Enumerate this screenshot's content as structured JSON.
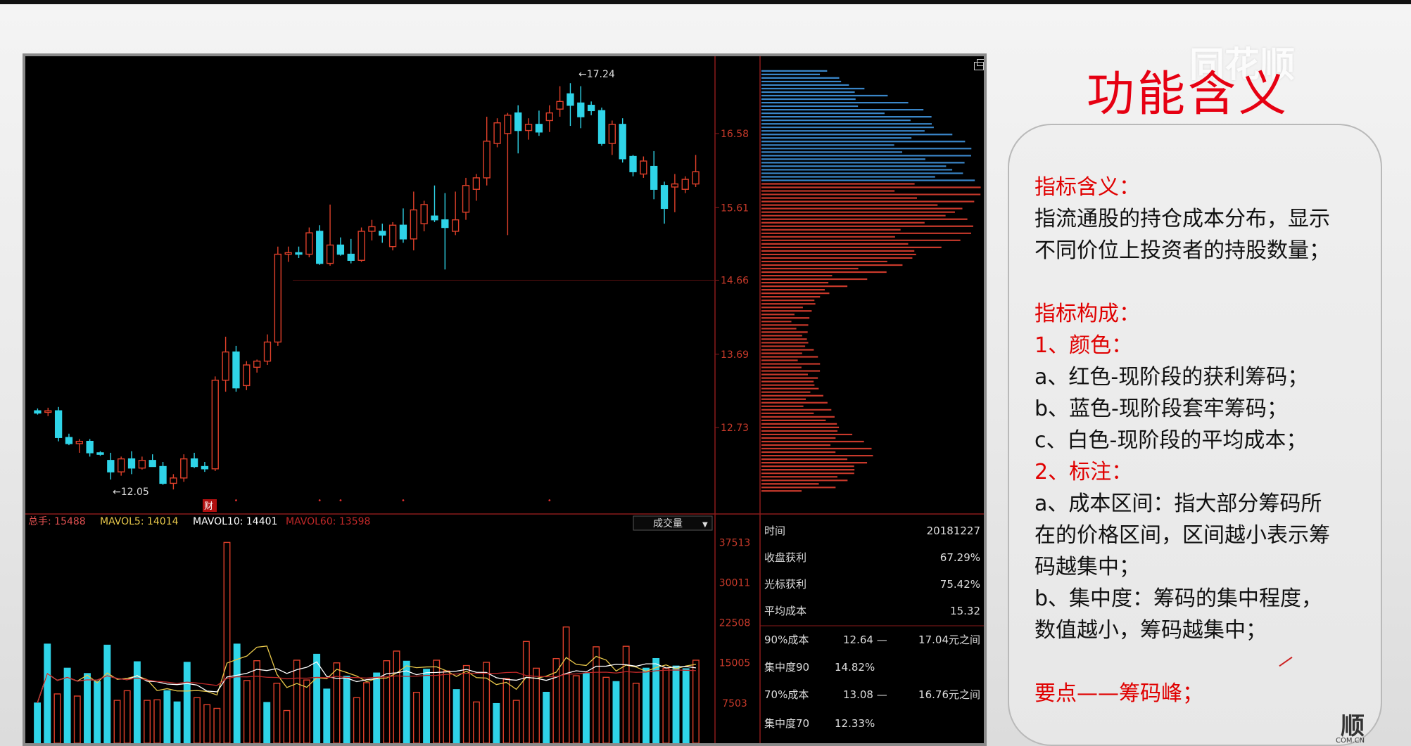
{
  "slide": {
    "title": "功能含义",
    "watermark": "同花顺",
    "corner_logo": "顺",
    "corner_url": "COM.CN"
  },
  "panel": {
    "section1_title": "指标含义：",
    "section1_line1": "指流通股的持仓成本分布，显示",
    "section1_line2": "不同价位上投资者的持股数量；",
    "section2_title": "指标构成：",
    "item1_title": "1、颜色：",
    "item1_a": "a、红色-现阶段的获利筹码；",
    "item1_b": "b、蓝色-现阶段套牢筹码；",
    "item1_c": "c、白色-现阶段的平均成本；",
    "item2_title": "2、标注：",
    "item2_a_line1": "a、成本区间：指大部分筹码所",
    "item2_a_line2": "在的价格区间，区间越小表示筹",
    "item2_a_line3": "码越集中；",
    "item2_b_line1": "b、集中度：筹码的集中程度，",
    "item2_b_line2": "数值越小，筹码越集中；",
    "keypoint": "要点——筹码峰；"
  },
  "chart_data": [
    {
      "type": "candlestick",
      "y_axis_ticks": [
        "16.58",
        "15.61",
        "14.66",
        "13.69",
        "12.73"
      ],
      "y_axis_values": [
        16.58,
        15.61,
        14.66,
        13.69,
        12.73
      ],
      "ylim": [
        11.7,
        17.5
      ],
      "high_annotation": "17.24",
      "low_annotation": "12.05",
      "event_marker": "财",
      "colors": {
        "up": "#e0402a",
        "down": "#2fd4e8",
        "red_chips": "#c8392b",
        "blue_chips": "#3a86c8"
      },
      "candles": [
        [
          12.95,
          12.98,
          12.9,
          12.92
        ],
        [
          12.93,
          12.99,
          12.88,
          12.95
        ],
        [
          12.95,
          13.0,
          12.55,
          12.6
        ],
        [
          12.6,
          12.65,
          12.5,
          12.52
        ],
        [
          12.52,
          12.58,
          12.4,
          12.55
        ],
        [
          12.55,
          12.58,
          12.35,
          12.4
        ],
        [
          12.4,
          12.42,
          12.36,
          12.38
        ],
        [
          12.3,
          12.4,
          12.05,
          12.15
        ],
        [
          12.15,
          12.35,
          12.1,
          12.32
        ],
        [
          12.32,
          12.42,
          12.12,
          12.2
        ],
        [
          12.2,
          12.35,
          12.18,
          12.3
        ],
        [
          12.3,
          12.38,
          12.22,
          12.22
        ],
        [
          12.22,
          12.28,
          11.98,
          12.0
        ],
        [
          12.0,
          12.12,
          11.92,
          12.07
        ],
        [
          12.07,
          12.38,
          12.02,
          12.32
        ],
        [
          12.32,
          12.4,
          12.2,
          12.22
        ],
        [
          12.22,
          12.28,
          12.15,
          12.19
        ],
        [
          12.19,
          13.4,
          12.16,
          13.35
        ],
        [
          13.35,
          13.92,
          13.2,
          13.72
        ],
        [
          13.72,
          13.8,
          13.2,
          13.25
        ],
        [
          13.28,
          13.6,
          13.22,
          13.55
        ],
        [
          13.52,
          13.62,
          13.45,
          13.6
        ],
        [
          13.6,
          13.95,
          13.55,
          13.85
        ],
        [
          13.85,
          15.1,
          13.8,
          15.0
        ],
        [
          15.0,
          15.1,
          14.9,
          15.02
        ],
        [
          15.02,
          15.1,
          14.95,
          15.0
        ],
        [
          15.0,
          15.35,
          14.96,
          15.28
        ],
        [
          15.3,
          15.38,
          14.86,
          14.88
        ],
        [
          14.88,
          15.65,
          14.85,
          15.12
        ],
        [
          15.12,
          15.22,
          14.98,
          15.0
        ],
        [
          15.0,
          15.2,
          14.88,
          14.92
        ],
        [
          14.92,
          15.35,
          14.9,
          15.3
        ],
        [
          15.3,
          15.45,
          15.18,
          15.36
        ],
        [
          15.3,
          15.4,
          15.15,
          15.25
        ],
        [
          15.1,
          15.42,
          15.05,
          15.38
        ],
        [
          15.38,
          15.6,
          15.15,
          15.2
        ],
        [
          15.2,
          15.82,
          15.05,
          15.58
        ],
        [
          15.4,
          15.7,
          15.3,
          15.65
        ],
        [
          15.5,
          15.9,
          15.42,
          15.45
        ],
        [
          15.45,
          15.8,
          14.8,
          15.35
        ],
        [
          15.3,
          15.82,
          15.25,
          15.45
        ],
        [
          15.55,
          16.0,
          15.45,
          15.9
        ],
        [
          15.85,
          16.05,
          15.7,
          16.0
        ],
        [
          16.0,
          16.8,
          15.9,
          16.48
        ],
        [
          16.45,
          16.78,
          16.4,
          16.72
        ],
        [
          16.58,
          16.85,
          15.25,
          16.82
        ],
        [
          16.85,
          16.95,
          16.32,
          16.62
        ],
        [
          16.62,
          16.78,
          16.5,
          16.7
        ],
        [
          16.7,
          16.88,
          16.55,
          16.6
        ],
        [
          16.75,
          16.95,
          16.6,
          16.85
        ],
        [
          16.9,
          17.2,
          16.8,
          17.0
        ],
        [
          17.1,
          17.24,
          16.68,
          16.95
        ],
        [
          16.98,
          17.2,
          16.65,
          16.8
        ],
        [
          16.95,
          17.0,
          16.82,
          16.88
        ],
        [
          16.88,
          16.92,
          16.42,
          16.45
        ],
        [
          16.45,
          16.75,
          16.3,
          16.7
        ],
        [
          16.7,
          16.78,
          16.2,
          16.25
        ],
        [
          16.28,
          16.3,
          16.02,
          16.08
        ],
        [
          16.05,
          16.28,
          16.0,
          16.22
        ],
        [
          16.15,
          16.35,
          15.72,
          15.85
        ],
        [
          15.9,
          15.95,
          15.4,
          15.6
        ],
        [
          15.88,
          16.05,
          15.55,
          15.92
        ],
        [
          15.85,
          16.02,
          15.8,
          15.98
        ],
        [
          15.92,
          16.3,
          15.88,
          16.08
        ]
      ]
    },
    {
      "type": "bar",
      "indicator_labels": {
        "total": "总手: 15488",
        "mavol5": "MAVOL5: 14014",
        "mavol10": "MAVOL10: 14401",
        "mavol60": "MAVOL60: 13598"
      },
      "dropdown": "成交量",
      "y_axis_ticks": [
        "37513",
        "30011",
        "22508",
        "15005",
        "7503"
      ],
      "ylim": [
        0,
        39000
      ],
      "values": [
        7500,
        18500,
        9200,
        14000,
        8800,
        13000,
        11500,
        18300,
        8000,
        9800,
        15200,
        8000,
        8100,
        9800,
        7700,
        15100,
        8500,
        7200,
        6500,
        37500,
        18500,
        11700,
        15400,
        7600,
        11200,
        6100,
        15500,
        11800,
        16600,
        10100,
        15000,
        12500,
        8500,
        11300,
        13100,
        15400,
        17200,
        15300,
        9500,
        13800,
        15500,
        13500,
        10000,
        14500,
        7700,
        15100,
        7400,
        12100,
        8000,
        19000,
        14000,
        9500,
        15800,
        21700,
        12600,
        13000,
        18000,
        12300,
        11500,
        18100,
        11200,
        14000,
        15800,
        14000,
        14400,
        13900,
        15500
      ],
      "up_down": [
        0,
        0,
        1,
        0,
        1,
        0,
        0,
        0,
        1,
        1,
        0,
        1,
        1,
        0,
        0,
        0,
        1,
        1,
        1,
        1,
        0,
        1,
        1,
        0,
        1,
        1,
        1,
        1,
        0,
        0,
        1,
        0,
        1,
        1,
        0,
        1,
        1,
        0,
        1,
        0,
        1,
        1,
        0,
        1,
        1,
        1,
        0,
        1,
        1,
        1,
        1,
        0,
        1,
        1,
        1,
        0,
        1,
        1,
        0,
        1,
        1,
        0,
        0,
        1,
        0,
        0,
        1
      ]
    }
  ],
  "info_panel": {
    "time_label": "时间",
    "time_value": "20181227",
    "close_profit_label": "收盘获利",
    "close_profit_value": "67.29%",
    "cursor_profit_label": "光标获利",
    "cursor_profit_value": "75.42%",
    "avg_cost_label": "平均成本",
    "avg_cost_value": "15.32",
    "cost90_label": "90%成本",
    "cost90_low": "12.64 —",
    "cost90_high": "17.04元之间",
    "conc90_label": "集中度90",
    "conc90_value": "14.82%",
    "cost70_label": "70%成本",
    "cost70_low": "13.08 —",
    "cost70_high": "16.76元之间",
    "conc70_label": "集中度70",
    "conc70_value": "12.33%"
  }
}
